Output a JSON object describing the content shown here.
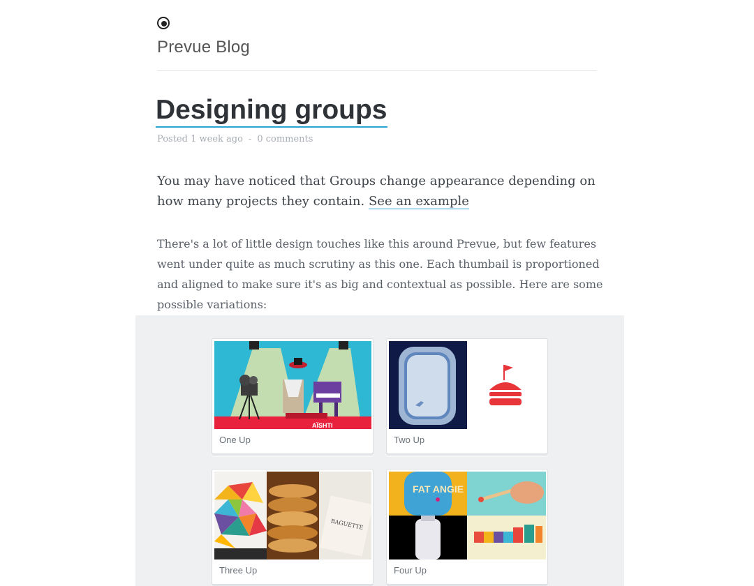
{
  "blog": {
    "logo_icon": "camera-lens-icon",
    "name": "Prevue Blog"
  },
  "post": {
    "title": "Designing groups",
    "meta": {
      "posted": "Posted 1 week ago",
      "separator": "-",
      "comments": "0 comments"
    },
    "lead_text": "You may have noticed that Groups change appearance depending on how many projects they contain.",
    "lead_link": "See an example",
    "body": "There's a lot of little design touches like this around Prevue, but few features went under quite as much scrutiny as this one. Each thumbail is proportioned and aligned to make sure it's as big and contextual as possible. Here are some possible variations:"
  },
  "groups": [
    {
      "label": "One Up",
      "thumb_sign": "AÏSHTI"
    },
    {
      "label": "Two Up"
    },
    {
      "label": "Three Up",
      "thumb_sign": "BAGUETTE"
    },
    {
      "label": "Four Up",
      "thumb_text": "FAT ANGIE"
    }
  ],
  "colors": {
    "accent": "#2aa3d9",
    "title": "#2f3338",
    "figure_bg": "#eef0f2"
  }
}
